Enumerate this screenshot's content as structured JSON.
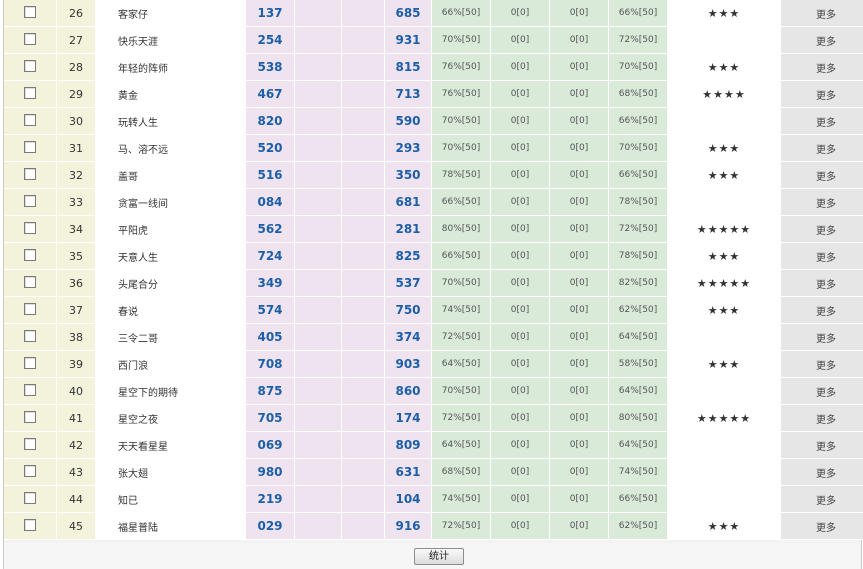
{
  "rows": [
    {
      "idx": "26",
      "name": "客家仔",
      "p1": "137",
      "p2": "685",
      "r1": "66%[50]",
      "r2": "0[0]",
      "r3": "0[0]",
      "r4": "66%[50]",
      "stars": "★★★",
      "more": "更多"
    },
    {
      "idx": "27",
      "name": "快乐天涯",
      "p1": "254",
      "p2": "931",
      "r1": "70%[50]",
      "r2": "0[0]",
      "r3": "0[0]",
      "r4": "72%[50]",
      "stars": "",
      "more": "更多"
    },
    {
      "idx": "28",
      "name": "年轻的阵师",
      "p1": "538",
      "p2": "815",
      "r1": "76%[50]",
      "r2": "0[0]",
      "r3": "0[0]",
      "r4": "70%[50]",
      "stars": "★★★",
      "more": "更多"
    },
    {
      "idx": "29",
      "name": "黄金",
      "p1": "467",
      "p2": "713",
      "r1": "76%[50]",
      "r2": "0[0]",
      "r3": "0[0]",
      "r4": "68%[50]",
      "stars": "★★★★",
      "more": "更多"
    },
    {
      "idx": "30",
      "name": "玩转人生",
      "p1": "820",
      "p2": "590",
      "r1": "70%[50]",
      "r2": "0[0]",
      "r3": "0[0]",
      "r4": "66%[50]",
      "stars": "",
      "more": "更多"
    },
    {
      "idx": "31",
      "name": "马、溶不远",
      "p1": "520",
      "p2": "293",
      "r1": "70%[50]",
      "r2": "0[0]",
      "r3": "0[0]",
      "r4": "70%[50]",
      "stars": "★★★",
      "more": "更多"
    },
    {
      "idx": "32",
      "name": "盖哥",
      "p1": "516",
      "p2": "350",
      "r1": "78%[50]",
      "r2": "0[0]",
      "r3": "0[0]",
      "r4": "66%[50]",
      "stars": "★★★",
      "more": "更多"
    },
    {
      "idx": "33",
      "name": "贪富一线间",
      "p1": "084",
      "p2": "681",
      "r1": "66%[50]",
      "r2": "0[0]",
      "r3": "0[0]",
      "r4": "78%[50]",
      "stars": "",
      "more": "更多"
    },
    {
      "idx": "34",
      "name": "平阳虎",
      "p1": "562",
      "p2": "281",
      "r1": "80%[50]",
      "r2": "0[0]",
      "r3": "0[0]",
      "r4": "72%[50]",
      "stars": "★★★★★",
      "more": "更多"
    },
    {
      "idx": "35",
      "name": "天意人生",
      "p1": "724",
      "p2": "825",
      "r1": "66%[50]",
      "r2": "0[0]",
      "r3": "0[0]",
      "r4": "78%[50]",
      "stars": "★★★",
      "more": "更多"
    },
    {
      "idx": "36",
      "name": "头尾合分",
      "p1": "349",
      "p2": "537",
      "r1": "70%[50]",
      "r2": "0[0]",
      "r3": "0[0]",
      "r4": "82%[50]",
      "stars": "★★★★★",
      "more": "更多"
    },
    {
      "idx": "37",
      "name": "春说",
      "p1": "574",
      "p2": "750",
      "r1": "74%[50]",
      "r2": "0[0]",
      "r3": "0[0]",
      "r4": "62%[50]",
      "stars": "★★★",
      "more": "更多"
    },
    {
      "idx": "38",
      "name": "三令二哥",
      "p1": "405",
      "p2": "374",
      "r1": "72%[50]",
      "r2": "0[0]",
      "r3": "0[0]",
      "r4": "64%[50]",
      "stars": "",
      "more": "更多"
    },
    {
      "idx": "39",
      "name": "西门浪",
      "p1": "708",
      "p2": "903",
      "r1": "64%[50]",
      "r2": "0[0]",
      "r3": "0[0]",
      "r4": "58%[50]",
      "stars": "★★★",
      "more": "更多"
    },
    {
      "idx": "40",
      "name": "星空下的期待",
      "p1": "875",
      "p2": "860",
      "r1": "70%[50]",
      "r2": "0[0]",
      "r3": "0[0]",
      "r4": "64%[50]",
      "stars": "",
      "more": "更多"
    },
    {
      "idx": "41",
      "name": "星空之夜",
      "p1": "705",
      "p2": "174",
      "r1": "72%[50]",
      "r2": "0[0]",
      "r3": "0[0]",
      "r4": "80%[50]",
      "stars": "★★★★★",
      "more": "更多"
    },
    {
      "idx": "42",
      "name": "天天看星星",
      "p1": "069",
      "p2": "809",
      "r1": "64%[50]",
      "r2": "0[0]",
      "r3": "0[0]",
      "r4": "64%[50]",
      "stars": "",
      "more": "更多"
    },
    {
      "idx": "43",
      "name": "张大翅",
      "p1": "980",
      "p2": "631",
      "r1": "68%[50]",
      "r2": "0[0]",
      "r3": "0[0]",
      "r4": "74%[50]",
      "stars": "",
      "more": "更多"
    },
    {
      "idx": "44",
      "name": "知已",
      "p1": "219",
      "p2": "104",
      "r1": "74%[50]",
      "r2": "0[0]",
      "r3": "0[0]",
      "r4": "66%[50]",
      "stars": "",
      "more": "更多"
    },
    {
      "idx": "45",
      "name": "福星普陆",
      "p1": "029",
      "p2": "916",
      "r1": "72%[50]",
      "r2": "0[0]",
      "r3": "0[0]",
      "r4": "62%[50]",
      "stars": "★★★",
      "more": "更多"
    }
  ],
  "footer": {
    "button_label": "统计"
  }
}
